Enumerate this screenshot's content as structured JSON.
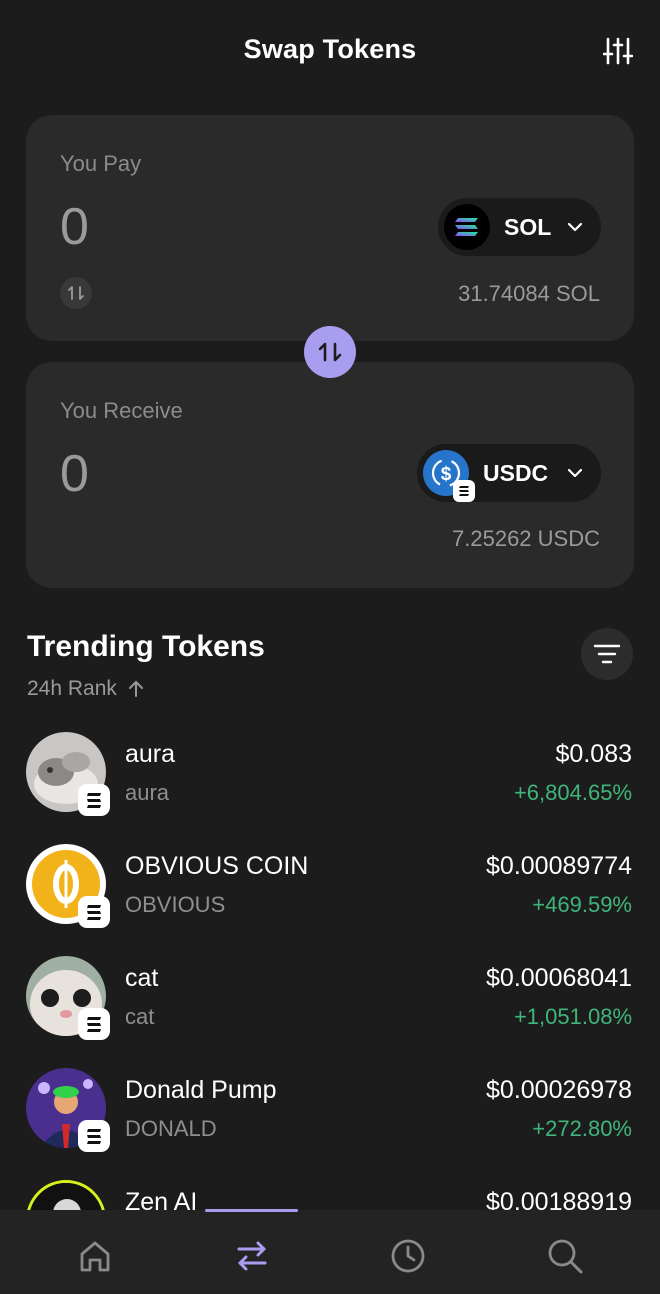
{
  "header": {
    "title": "Swap Tokens",
    "settings_icon": "sliders-icon"
  },
  "pay": {
    "label": "You Pay",
    "amount": "0",
    "token": "SOL",
    "balance": "31.74084 SOL"
  },
  "receive": {
    "label": "You Receive",
    "amount": "0",
    "token": "USDC",
    "balance": "7.25262 USDC"
  },
  "trending": {
    "title": "Trending Tokens",
    "rank_label": "24h Rank",
    "tokens": [
      {
        "name": "aura",
        "symbol": "aura",
        "price": "$0.083",
        "change": "+6,804.65%"
      },
      {
        "name": "OBVIOUS COIN",
        "symbol": "OBVIOUS",
        "price": "$0.00089774",
        "change": "+469.59%"
      },
      {
        "name": "cat",
        "symbol": "cat",
        "price": "$0.00068041",
        "change": "+1,051.08%"
      },
      {
        "name": "Donald Pump",
        "symbol": "DONALD",
        "price": "$0.00026978",
        "change": "+272.80%"
      },
      {
        "name": "Zen AI",
        "symbol": "",
        "price": "$0.00188919",
        "change": ""
      }
    ]
  },
  "nav": {
    "items": [
      "home-icon",
      "swap-icon",
      "clock-icon",
      "search-icon"
    ],
    "active": "swap-icon"
  },
  "colors": {
    "accent": "#a99df0",
    "positive": "#3fb57a",
    "background": "#1c1c1c",
    "card": "#2a2a2a"
  }
}
